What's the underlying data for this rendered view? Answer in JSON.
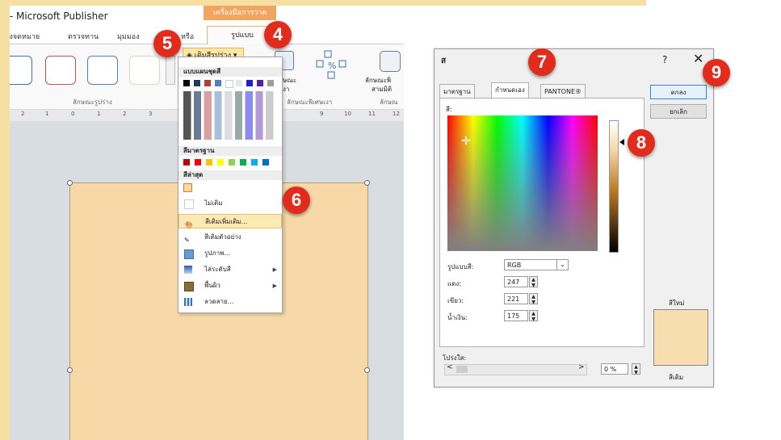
{
  "publisher": {
    "title": ": - Microsoft Publisher",
    "context_tab": "เครื่องมือการวาด",
    "tabs": [
      "ส่งจดหมาย",
      "ตรวจทาน",
      "มุมมอง",
      "หรือ",
      "รูปแบบ"
    ],
    "fill_button": "เติมสีรูปร่าง",
    "ribbon_groups": [
      "ลักษณะรูปร่าง",
      "ลักษณะพิเศษเงา",
      "ลักษณะพิเ สามมิติ",
      "ลักษณ"
    ],
    "ribbon_small": [
      "ษณะ",
      "งา",
      "ลักษณะพิ",
      "สามมิติ"
    ],
    "ruler_marks": [
      "2",
      "1",
      "0",
      "1",
      "2",
      "3",
      "9",
      "10",
      "11",
      "12"
    ],
    "shape_fill_color": "#f7d9a8"
  },
  "fill_menu": {
    "theme_header": "แบบแผนชุดสี",
    "standard_header": "สีมาตรฐาน",
    "recent_header": "สีล่าสุด",
    "theme_top_row": [
      "#000000",
      "#1f3864",
      "#2e4a7d",
      "#b23b3b",
      "#4f81bd",
      "#ffffff",
      "#1f1fd1",
      "#5a1f9c",
      "#9e9e9e"
    ],
    "standard_row": [
      "#c00000",
      "#ff0000",
      "#ffc000",
      "#ffff00",
      "#92d050",
      "#00b050",
      "#00b0f0",
      "#0070c0"
    ],
    "recent": "#f7d9a8",
    "items": [
      {
        "label": "ไม่เติม",
        "icon": "no-fill-icon",
        "sub": false
      },
      {
        "label": "สีเติมเพิ่มเติม...",
        "icon": "more-fill-colors-icon",
        "sub": false,
        "highlight": true
      },
      {
        "label": "สีเติมตัวอย่าง",
        "icon": "eyedropper-icon",
        "sub": false
      },
      {
        "label": "รูปภาพ...",
        "icon": "picture-icon",
        "sub": false
      },
      {
        "label": "ไล่ระดับสี",
        "icon": "gradient-icon",
        "sub": true
      },
      {
        "label": "พื้นผิว",
        "icon": "texture-icon",
        "sub": true
      },
      {
        "label": "ลวดลาย...",
        "icon": "pattern-icon",
        "sub": false
      }
    ]
  },
  "dialog": {
    "title": "ส",
    "help": "?",
    "close": "✕",
    "tabs": [
      "มาตรฐาน",
      "กำหนดเอง",
      "PANTONE®"
    ],
    "colors_label": "สี:",
    "color_model_label": "รูปแบบสี:",
    "color_model": "RGB",
    "red_label": "แดง:",
    "green_label": "เขียว:",
    "blue_label": "น้ำเงิน:",
    "red": "247",
    "green": "221",
    "blue": "175",
    "transparency_label": "โปร่งใส:",
    "transparency_value": "0 %",
    "ok": "ตกลง",
    "cancel": "ยกเลิก",
    "new_label": "สีใหม่",
    "current_label": "สีเดิม",
    "new_color": "#f7ddaf"
  },
  "steps": [
    "4",
    "5",
    "6",
    "7",
    "8",
    "9"
  ]
}
